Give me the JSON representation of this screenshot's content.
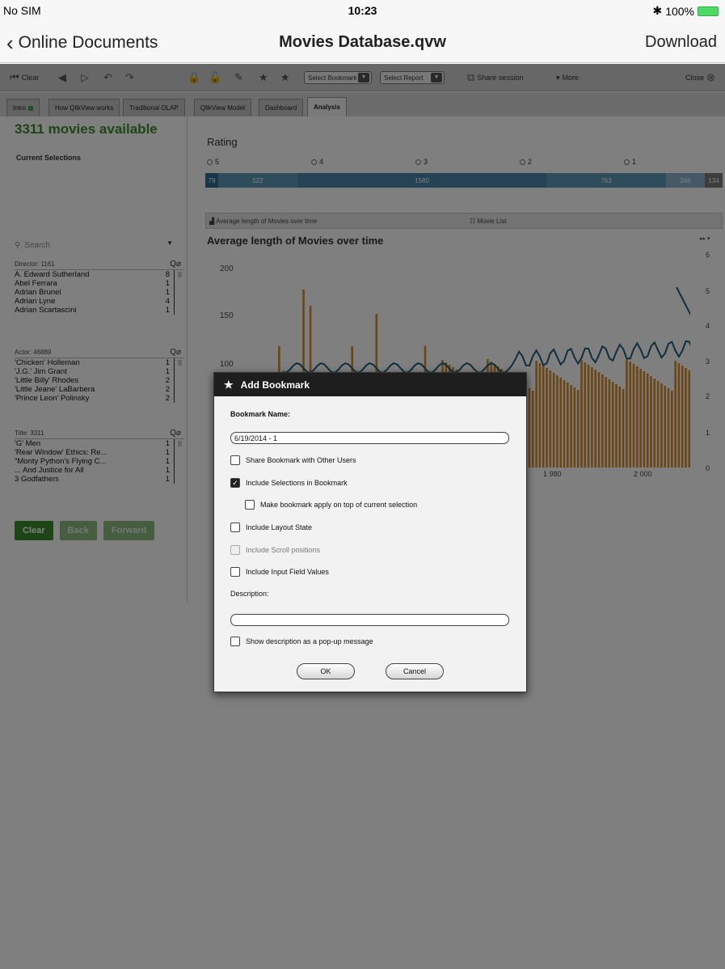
{
  "status_bar": {
    "carrier": "No SIM",
    "time": "10:23",
    "battery": "100%"
  },
  "nav": {
    "back_label": "Online Documents",
    "title": "Movies Database.qvw",
    "download_label": "Download"
  },
  "toolbar": {
    "clear_label": "Clear",
    "select_bookmark": "Select Bookmark",
    "select_report": "Select Report",
    "share_session": "Share session",
    "more": "More",
    "close": "Close"
  },
  "tabs": [
    "Intro",
    "How QlikView works",
    "Traditional OLAP",
    "QlikView Model",
    "Dashboard",
    "Analysis"
  ],
  "left": {
    "movies_available": "3311 movies available",
    "current_selections": "Current Selections",
    "search_placeholder": "Search",
    "listboxes": [
      {
        "header": "Director: 1161",
        "rows": [
          {
            "name": "A. Edward Sutherland",
            "count": "8"
          },
          {
            "name": "Abel Ferrara",
            "count": "1"
          },
          {
            "name": "Adrian Brunel",
            "count": "1"
          },
          {
            "name": "Adrian Lyne",
            "count": "4"
          },
          {
            "name": "Adrian Scartascini",
            "count": "1"
          }
        ]
      },
      {
        "header": "Actor: 46889",
        "rows": [
          {
            "name": "'Chicken' Holleman",
            "count": "1"
          },
          {
            "name": "'J.G.' Jim Grant",
            "count": "1"
          },
          {
            "name": "'Little Billy' Rhodes",
            "count": "2"
          },
          {
            "name": "'Little Jeane' LaBarbera",
            "count": "2"
          },
          {
            "name": "'Prince Leon' Polinsky",
            "count": "2"
          }
        ]
      },
      {
        "header": "Title: 3311",
        "rows": [
          {
            "name": "'G' Men",
            "count": "1"
          },
          {
            "name": "'Rear Window' Ethics: Re...",
            "count": "1"
          },
          {
            "name": "\"Monty Python's Flying C...",
            "count": "1"
          },
          {
            "name": "... And Justice for All",
            "count": "1"
          },
          {
            "name": "3 Godfathers",
            "count": "1"
          }
        ]
      }
    ],
    "buttons": {
      "clear": "Clear",
      "back": "Back",
      "forward": "Forward"
    }
  },
  "rating": {
    "title": "Rating",
    "options": [
      "5",
      "4",
      "3",
      "2",
      "1"
    ],
    "segments": [
      {
        "label": "79",
        "color": "#2f6f93"
      },
      {
        "label": "522",
        "color": "#5c98b8"
      },
      {
        "label": "1580",
        "color": "#4a86a8"
      },
      {
        "label": "763",
        "color": "#5c98b8"
      },
      {
        "label": "246",
        "color": "#8ab5cc"
      },
      {
        "label": "134",
        "color": "#7a7a7a"
      }
    ]
  },
  "chart_tabs": {
    "tab1": "Average length of Movies over time",
    "tab2": "Movie List"
  },
  "chart_data": {
    "type": "bar",
    "title": "Average length of Movies over time",
    "y_left_ticks": [
      "200",
      "150",
      "100"
    ],
    "y_right_ticks": [
      "6",
      "5",
      "4",
      "3",
      "2",
      "1",
      "0"
    ],
    "x_ticks": [
      "1 980",
      "2 000"
    ],
    "colors": {
      "bars": "#d98a2b",
      "line": "#1f5f7a"
    }
  },
  "dialog": {
    "title": "Add Bookmark",
    "name_label": "Bookmark Name:",
    "name_value": "6/19/2014 - 1",
    "options": [
      {
        "label": "Share Bookmark with Other Users",
        "checked": false,
        "disabled": false
      },
      {
        "label": "Include Selections in Bookmark",
        "checked": true,
        "disabled": false
      },
      {
        "label": "Make bookmark apply on top of current selection",
        "checked": false,
        "disabled": false
      },
      {
        "label": "Include Layout State",
        "checked": false,
        "disabled": false
      },
      {
        "label": "Include Scroll positions",
        "checked": false,
        "disabled": true
      },
      {
        "label": "Include Input Field Values",
        "checked": false,
        "disabled": false
      }
    ],
    "description_label": "Description:",
    "description_value": "",
    "popup_label": "Show description as a pop-up message",
    "ok": "OK",
    "cancel": "Cancel"
  }
}
